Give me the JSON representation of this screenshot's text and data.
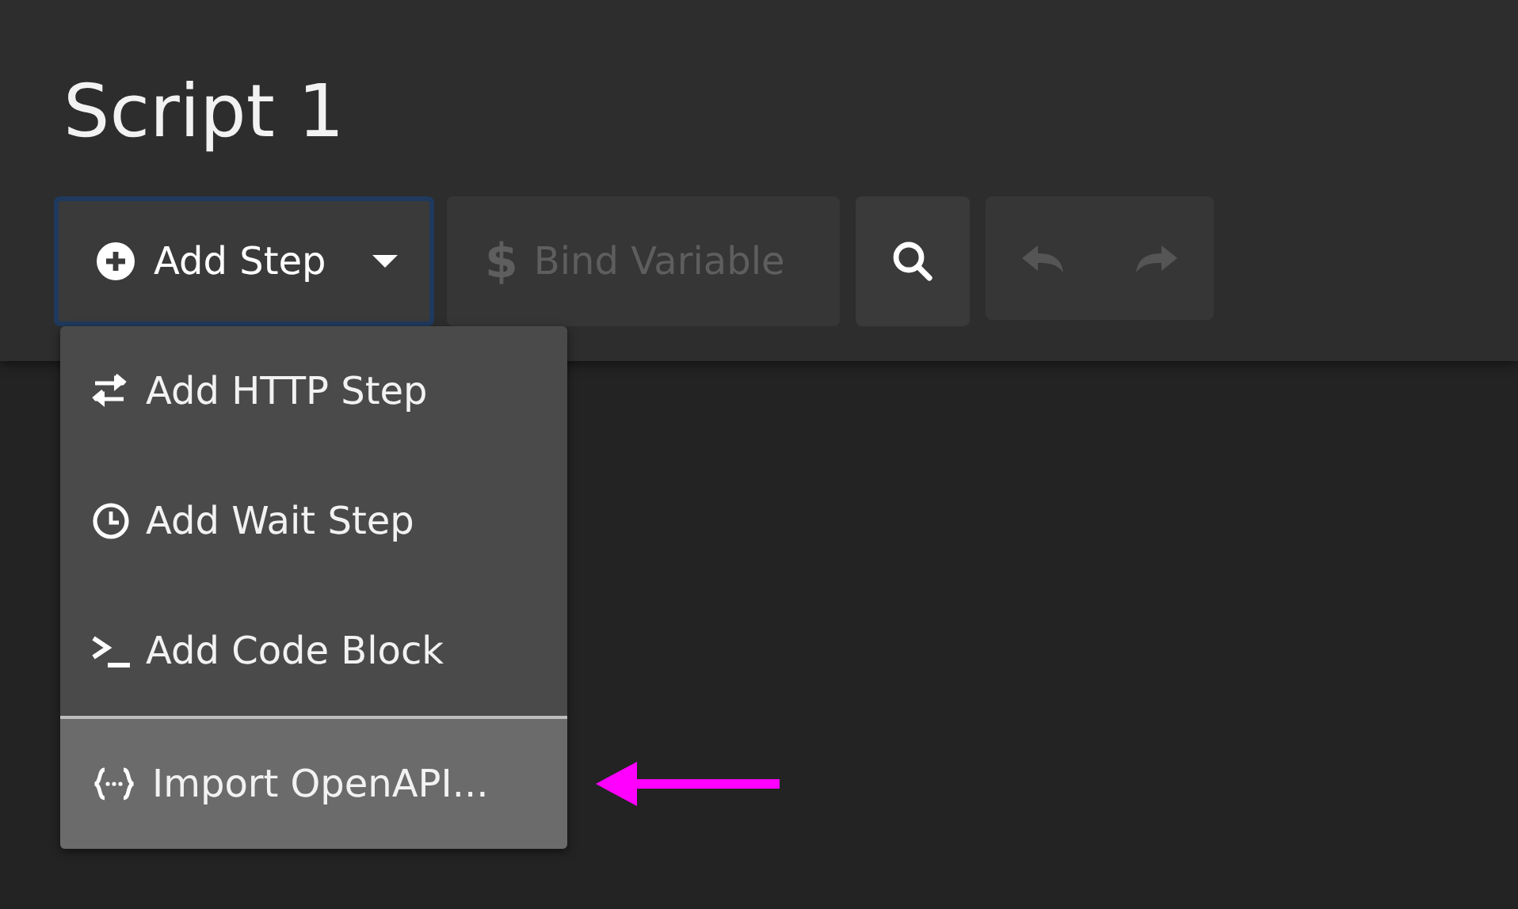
{
  "title": "Script 1",
  "toolbar": {
    "add_step": {
      "label": "Add Step",
      "focused": true
    },
    "bind_variable": {
      "label": "Bind Variable",
      "icon": "$",
      "disabled": true
    },
    "search": {
      "disabled": false
    },
    "history": {
      "disabled": true
    }
  },
  "menu": {
    "items": [
      {
        "kind": "http",
        "label": "Add HTTP Step",
        "highlighted": false,
        "divider_above": false
      },
      {
        "kind": "wait",
        "label": "Add Wait Step",
        "highlighted": false,
        "divider_above": false
      },
      {
        "kind": "code",
        "label": "Add Code Block",
        "highlighted": false,
        "divider_above": false
      },
      {
        "kind": "import",
        "label": "Import OpenAPI...",
        "highlighted": true,
        "divider_above": true
      }
    ]
  },
  "annotation": {
    "kind": "arrow",
    "color": "#ff00ff"
  }
}
